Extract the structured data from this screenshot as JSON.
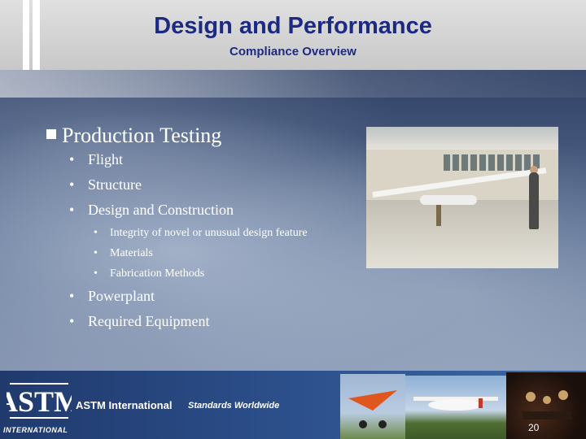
{
  "header": {
    "title": "Design and Performance",
    "subtitle": "Compliance Overview"
  },
  "content": {
    "heading": "Production Testing",
    "items": [
      {
        "label": "Flight"
      },
      {
        "label": "Structure"
      },
      {
        "label": "Design and Construction"
      }
    ],
    "sub_items": [
      {
        "label": "Integrity of novel or unusual design feature"
      },
      {
        "label": "Materials"
      },
      {
        "label": "Fabrication Methods"
      }
    ],
    "items_after": [
      {
        "label": "Powerplant"
      },
      {
        "label": "Required Equipment"
      }
    ],
    "bullet": "•"
  },
  "footer": {
    "logo_text": "INTERNATIONAL",
    "logo_letters": "ASTM",
    "brand": "ASTM International",
    "tagline": "Standards Worldwide",
    "page_number": "20"
  },
  "colors": {
    "title": "#1c2a82",
    "footer": "#2b4d88"
  }
}
